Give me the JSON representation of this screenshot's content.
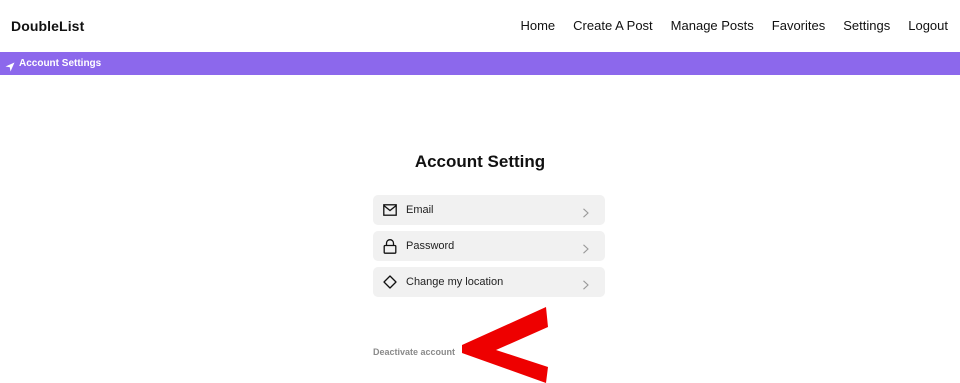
{
  "header": {
    "logo": "DoubleList",
    "nav": [
      {
        "label": "Home"
      },
      {
        "label": "Create A Post"
      },
      {
        "label": "Manage Posts"
      },
      {
        "label": "Favorites"
      },
      {
        "label": "Settings"
      },
      {
        "label": "Logout"
      }
    ]
  },
  "breadcrumb": {
    "icon": "navigation-arrow-icon",
    "label": "Account Settings",
    "color": "#8c68ec"
  },
  "main": {
    "title": "Account Setting",
    "items": [
      {
        "label": "Email",
        "icon": "mail-icon"
      },
      {
        "label": "Password",
        "icon": "lock-icon"
      },
      {
        "label": "Change my location",
        "icon": "diamond-icon"
      }
    ],
    "deactivate_label": "Deactivate account"
  },
  "annotation": {
    "shape": "red-arrow-pointer",
    "color": "#ee0000"
  }
}
